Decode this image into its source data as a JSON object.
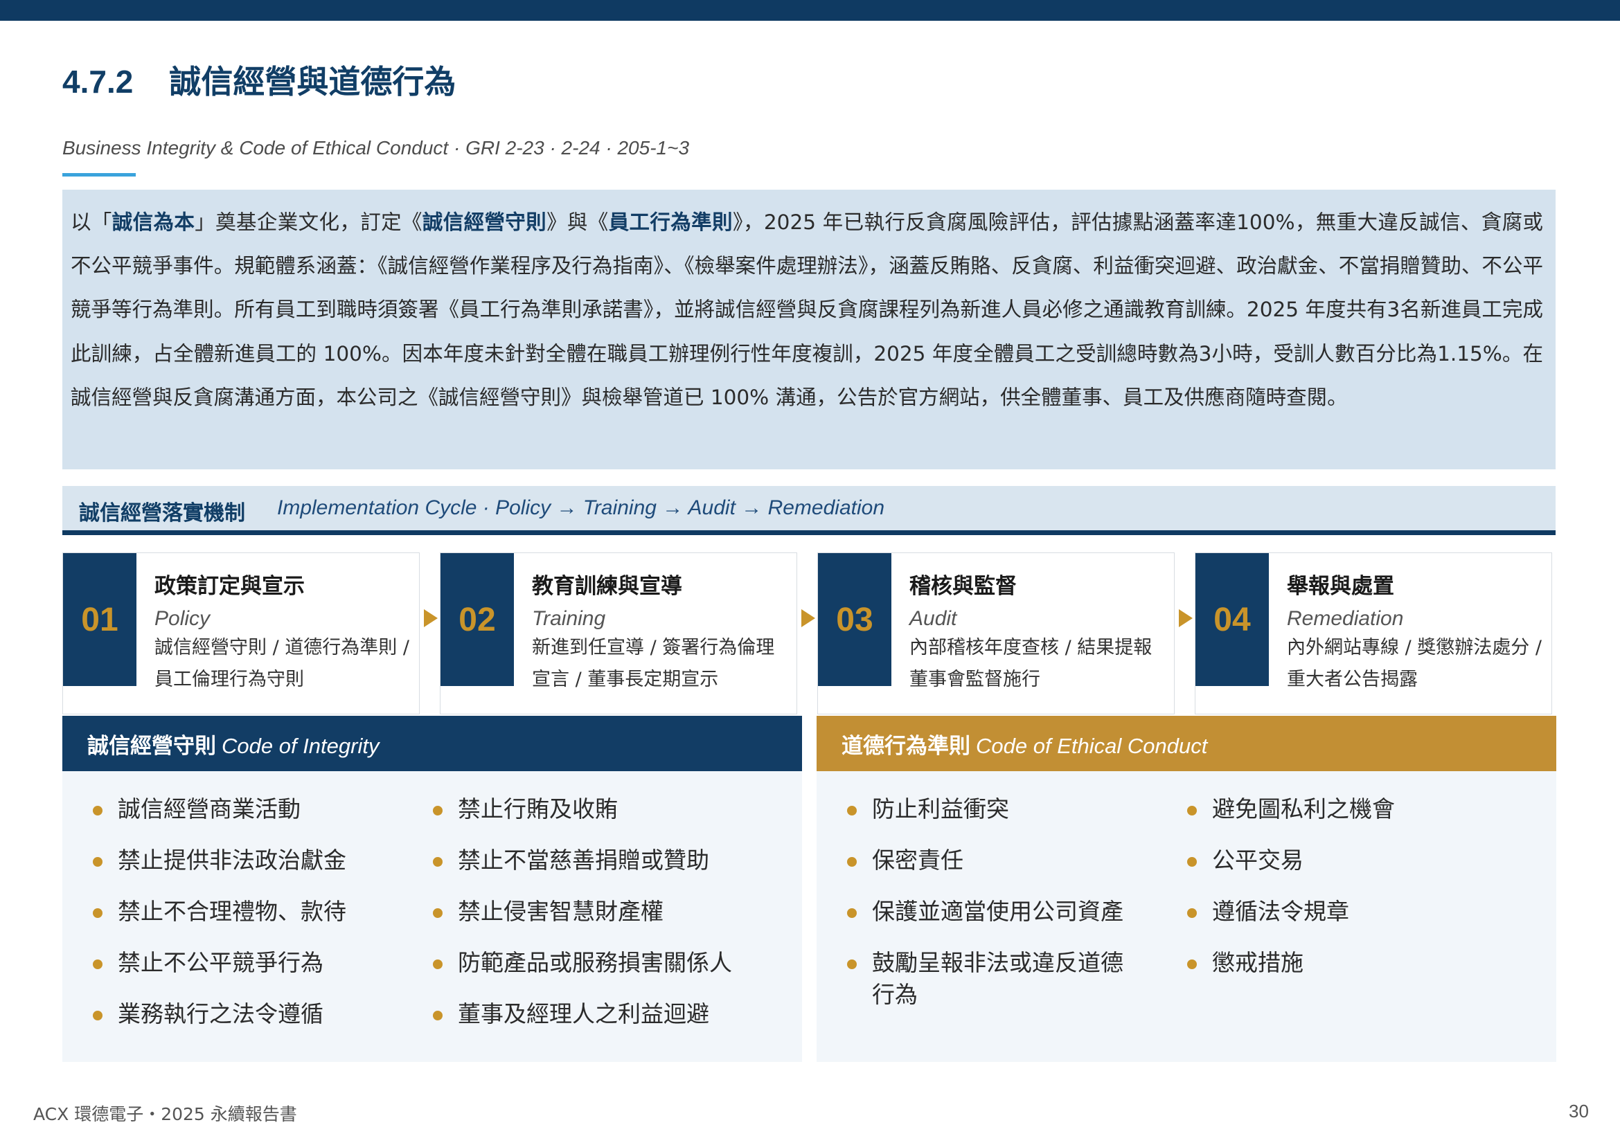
{
  "section": {
    "number": "4.7.2",
    "title": "誠信經營與道德行為",
    "subtitle": "Business Integrity & Code of Ethical Conduct · GRI 2-23 · 2-24 · 205-1~3"
  },
  "intro": {
    "p1": "以「",
    "b1": "誠信為本",
    "p2": "」奠基企業文化，訂定《",
    "b2": "誠信經營守則",
    "p3": "》與《",
    "b3": "員工行為準則",
    "p4": "》，2025 年已執行反貪腐風險評估，評估據點涵蓋率達100%，無重大違反誠信、貪腐或不公平競爭事件。規範體系涵蓋：《誠信經營作業程序及行為指南》、《檢舉案件處理辦法》，涵蓋反賄賂、反貪腐、利益衝突迴避、政治獻金、不當捐贈贊助、不公平競爭等行為準則。所有員工到職時須簽署《員工行為準則承諾書》，並將誠信經營與反貪腐課程列為新進人員必修之通識教育訓練。2025 年度共有3名新進員工完成此訓練，占全體新進員工的 100%。因本年度未針對全體在職員工辦理例行性年度複訓，2025 年度全體員工之受訓總時數為3小時，受訓人數百分比為1.15%。在誠信經營與反貪腐溝通方面，本公司之《誠信經營守則》與檢舉管道已 100% 溝通，公告於官方網站，供全體董事、員工及供應商隨時查閱。"
  },
  "mechanism": {
    "title": "誠信經營落實機制",
    "subtitle": "Implementation Cycle · Policy → Training → Audit → Remediation",
    "steps": [
      {
        "num": "01",
        "title": "政策訂定與宣示",
        "en": "Policy",
        "desc": "誠信經營守則 / 道德行為準則 / 員工倫理行為守則"
      },
      {
        "num": "02",
        "title": "教育訓練與宣導",
        "en": "Training",
        "desc": "新進到任宣導 / 簽署行為倫理宣言 / 董事長定期宣示"
      },
      {
        "num": "03",
        "title": "稽核與監督",
        "en": "Audit",
        "desc": "內部稽核年度查核 / 結果提報董事會監督施行"
      },
      {
        "num": "04",
        "title": "舉報與處置",
        "en": "Remediation",
        "desc": "內外網站專線 / 獎懲辦法處分 / 重大者公告揭露"
      }
    ]
  },
  "integrity": {
    "title_zh": "誠信經營守則",
    "title_en": "Code of Integrity",
    "col1": [
      "誠信經營商業活動",
      "禁止提供非法政治獻金",
      "禁止不合理禮物、款待",
      "禁止不公平競爭行為",
      "業務執行之法令遵循"
    ],
    "col2": [
      "禁止行賄及收賄",
      "禁止不當慈善捐贈或贊助",
      "禁止侵害智慧財產權",
      "防範產品或服務損害關係人",
      "董事及經理人之利益迴避"
    ]
  },
  "ethics": {
    "title_zh": "道德行為準則",
    "title_en": "Code of Ethical Conduct",
    "col1": [
      "防止利益衝突",
      "保密責任",
      "保護並適當使用公司資產",
      "鼓勵呈報非法或違反道德行為"
    ],
    "col2": [
      "避免圖私利之機會",
      "公平交易",
      "遵循法令規章",
      "懲戒措施"
    ]
  },
  "footer": {
    "left": "ACX 環德電子・2025 永續報告書",
    "page": "30"
  },
  "colors": {
    "navy": "#0f3a62",
    "gold": "#c9942a",
    "light_blue_bg": "#d4e2ee",
    "accent_blue": "#3aa3dc"
  }
}
